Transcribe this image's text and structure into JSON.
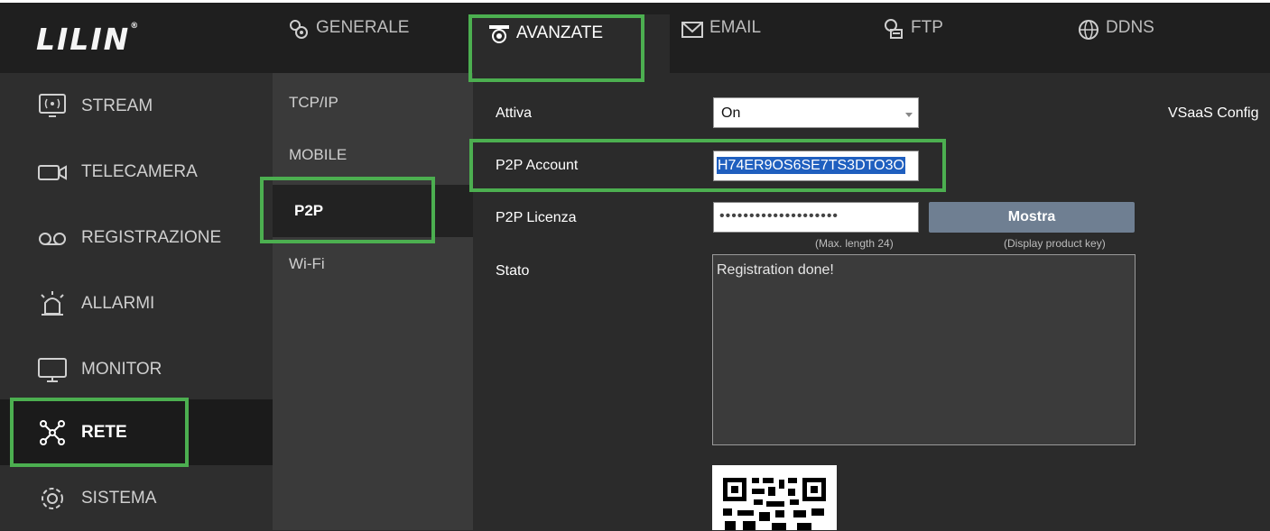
{
  "brand": {
    "logo_text": "LILIN"
  },
  "top_tabs": [
    {
      "label": "GENERALE",
      "icon": "gears-icon"
    },
    {
      "label": "AVANZATE",
      "icon": "advanced-camera-icon",
      "active": true
    },
    {
      "label": "EMAIL",
      "icon": "envelope-icon"
    },
    {
      "label": "FTP",
      "icon": "ftp-server-icon"
    },
    {
      "label": "DDNS",
      "icon": "globe-icon"
    }
  ],
  "sidebar": {
    "items": [
      {
        "label": "STREAM",
        "icon": "stream-monitor-icon"
      },
      {
        "label": "TELECAMERA",
        "icon": "camera-icon"
      },
      {
        "label": "REGISTRAZIONE",
        "icon": "recording-icon"
      },
      {
        "label": "ALLARMI",
        "icon": "alarm-siren-icon"
      },
      {
        "label": "MONITOR",
        "icon": "monitor-icon"
      },
      {
        "label": "RETE",
        "icon": "network-icon",
        "active": true
      },
      {
        "label": "SISTEMA",
        "icon": "gear-icon"
      }
    ]
  },
  "submenu": {
    "items": [
      {
        "label": "TCP/IP"
      },
      {
        "label": "MOBILE"
      },
      {
        "label": "P2P",
        "active": true
      },
      {
        "label": "Wi-Fi"
      }
    ]
  },
  "form": {
    "attiva_label": "Attiva",
    "attiva_value": "On",
    "account_label": "P2P Account",
    "account_value": "H74ER9OS6SE7TS3DTO3O",
    "license_label": "P2P Licenza",
    "license_value": "••••••••••••••••••••",
    "license_hint": "(Max. length 24)",
    "show_button": "Mostra",
    "show_hint": "(Display product key)",
    "status_label": "Stato",
    "status_value": "Registration done!",
    "vsaas_label": "VSaaS Config"
  },
  "colors": {
    "highlight": "#4caf50",
    "selection": "#1f5fbf",
    "button": "#6f7f92"
  }
}
